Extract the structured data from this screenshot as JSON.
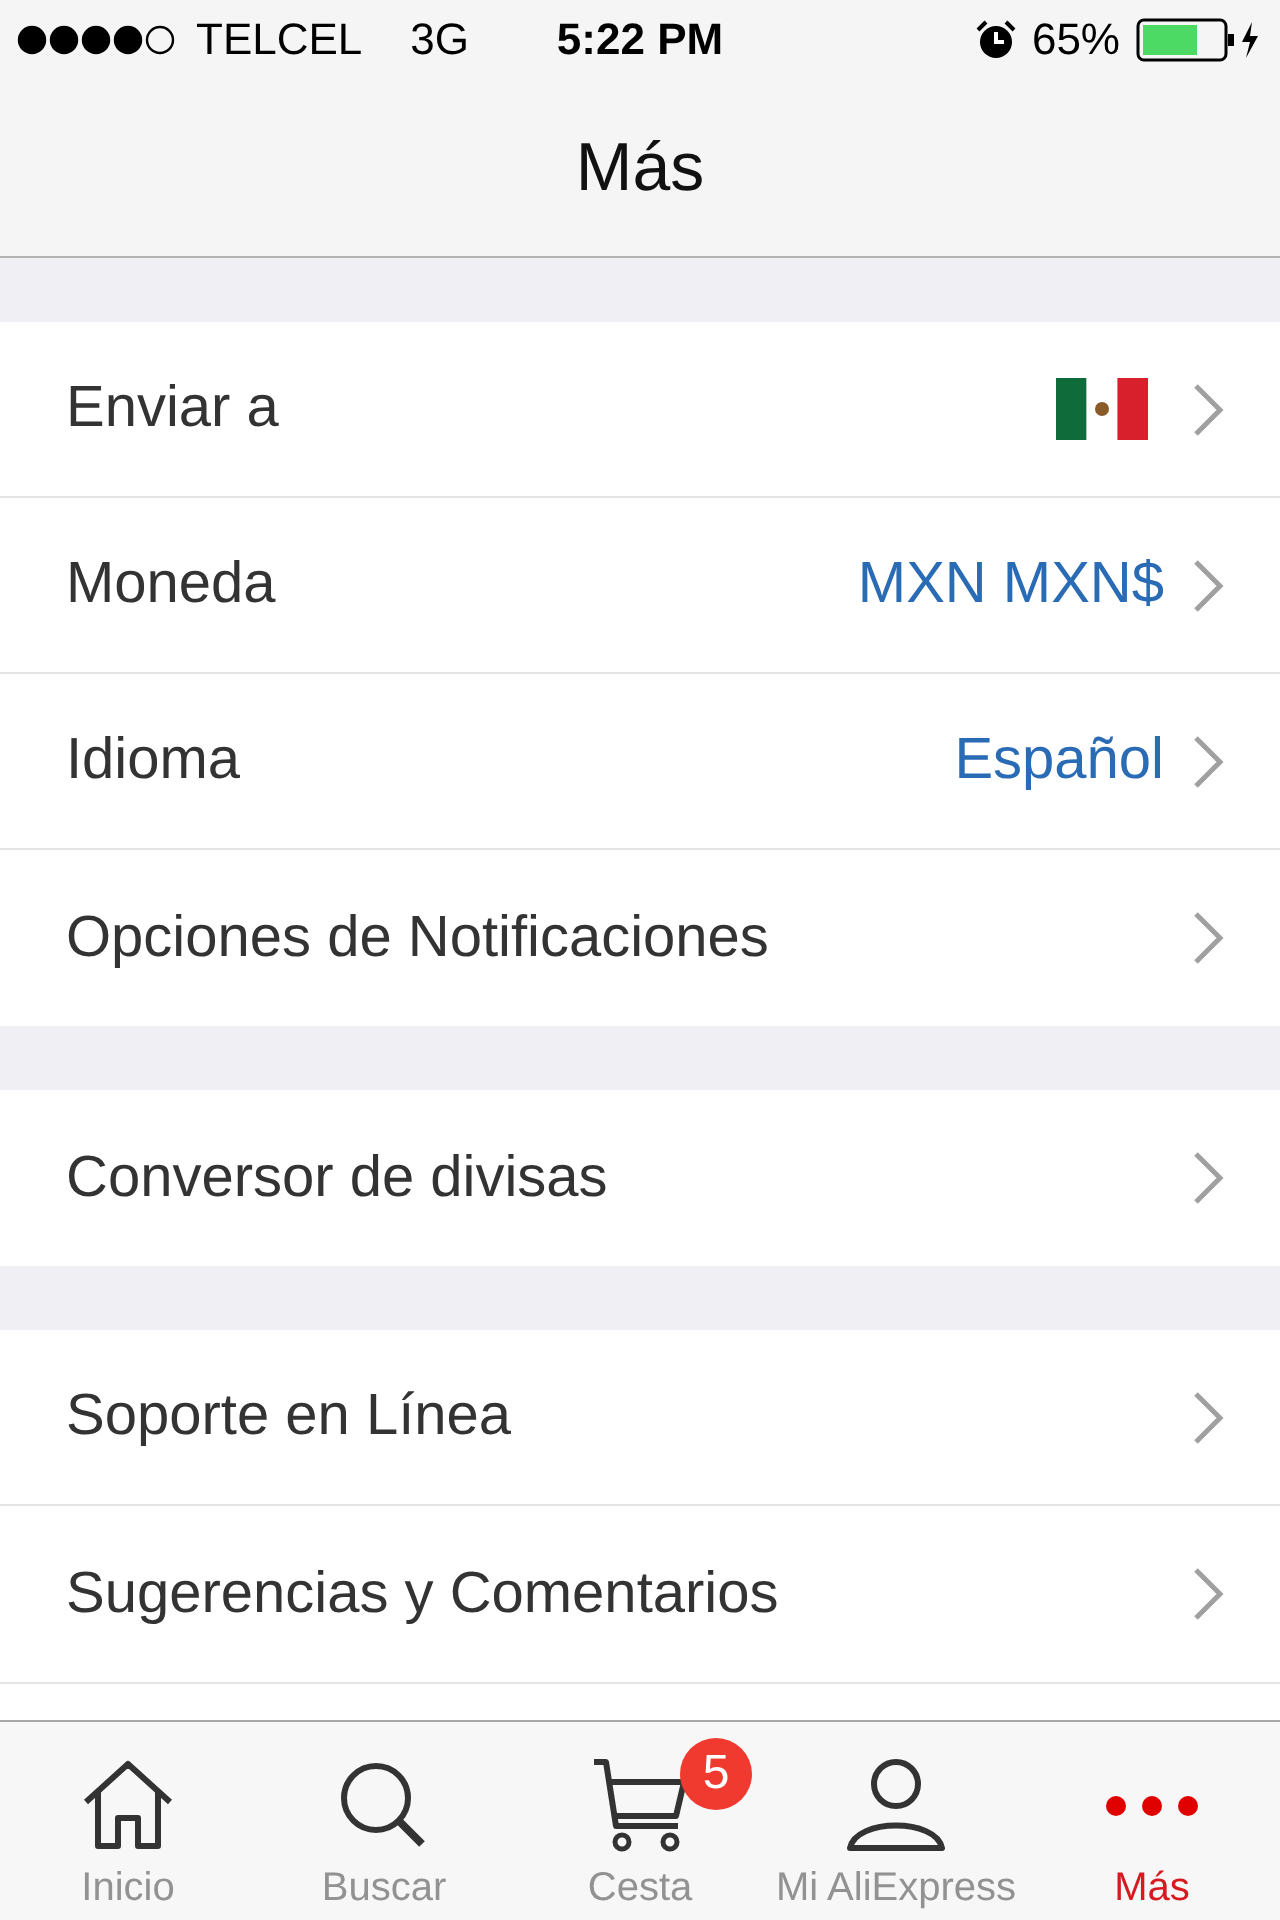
{
  "status_bar": {
    "carrier": "TELCEL",
    "network": "3G",
    "time": "5:22 PM",
    "battery": "65%"
  },
  "nav": {
    "title": "Más"
  },
  "sections": [
    {
      "rows": [
        {
          "label": "Enviar a",
          "kind": "flag"
        },
        {
          "label": "Moneda",
          "kind": "value",
          "value": "MXN MXN$"
        },
        {
          "label": "Idioma",
          "kind": "value",
          "value": "Español"
        },
        {
          "label": "Opciones de Notificaciones",
          "kind": "plain"
        }
      ]
    },
    {
      "rows": [
        {
          "label": "Conversor de divisas",
          "kind": "plain"
        }
      ]
    },
    {
      "rows": [
        {
          "label": "Soporte en Línea",
          "kind": "plain"
        },
        {
          "label": "Sugerencias y Comentarios",
          "kind": "plain"
        }
      ]
    }
  ],
  "tab_bar": [
    {
      "label": "Inicio",
      "kind": "home",
      "selected": false
    },
    {
      "label": "Buscar",
      "kind": "search",
      "selected": false
    },
    {
      "label": "Cesta",
      "kind": "cart",
      "selected": false,
      "badge": "5"
    },
    {
      "label": "Mi AliExpress",
      "kind": "person",
      "selected": false
    },
    {
      "label": "Más",
      "kind": "more",
      "selected": true
    }
  ]
}
